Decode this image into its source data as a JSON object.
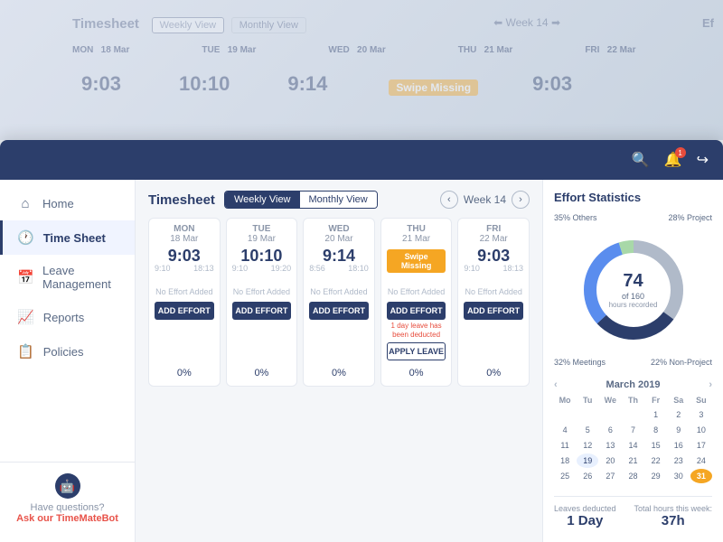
{
  "app": {
    "title": "Timesheet",
    "bg_week": "Week 14",
    "eff_label": "Ef"
  },
  "topbar": {
    "bell_count": "1"
  },
  "sidebar": {
    "items": [
      {
        "id": "home",
        "label": "Home",
        "icon": "⌂",
        "active": false
      },
      {
        "id": "timesheet",
        "label": "Time Sheet",
        "icon": "🕐",
        "active": true
      },
      {
        "id": "leave",
        "label": "Leave Management",
        "icon": "📅",
        "active": false
      },
      {
        "id": "reports",
        "label": "Reports",
        "icon": "📈",
        "active": false
      },
      {
        "id": "policies",
        "label": "Policies",
        "icon": "📋",
        "active": false
      }
    ],
    "help_text": "Have questions?",
    "bot_link": "Ask our TimeMateBot"
  },
  "timesheet": {
    "title": "Timesheet",
    "views": [
      {
        "label": "Weekly View",
        "active": true
      },
      {
        "label": "Monthly View",
        "active": false
      }
    ],
    "week_label": "Week 14",
    "days": [
      {
        "day": "MON",
        "date": "18 Mar",
        "time": "9:03",
        "time_start": "9:10",
        "time_end": "18:13",
        "swipe_missing": false,
        "no_effort": "No Effort Added",
        "add_effort": "ADD EFFORT",
        "percent": "0%"
      },
      {
        "day": "TUE",
        "date": "19 Mar",
        "time": "10:10",
        "time_start": "9:10",
        "time_end": "19:20",
        "swipe_missing": false,
        "no_effort": "No Effort Added",
        "add_effort": "ADD EFFORT",
        "percent": "0%"
      },
      {
        "day": "WED",
        "date": "20 Mar",
        "time": "9:14",
        "time_start": "8:56",
        "time_end": "18:10",
        "swipe_missing": false,
        "no_effort": "No Effort Added",
        "add_effort": "ADD EFFORT",
        "percent": "0%"
      },
      {
        "day": "THU",
        "date": "21 Mar",
        "time": "",
        "time_start": "",
        "time_end": "",
        "swipe_missing": true,
        "swipe_label": "Swipe Missing",
        "no_effort": "No Effort Added",
        "add_effort": "ADD EFFORT",
        "leave_note": "1 day leave has been deducted",
        "apply_leave": "APPLY LEAVE",
        "percent": "0%"
      },
      {
        "day": "FRI",
        "date": "22 Mar",
        "time": "9:03",
        "time_start": "9:10",
        "time_end": "18:13",
        "swipe_missing": false,
        "no_effort": "No Effort Added",
        "add_effort": "ADD EFFORT",
        "percent": "0%"
      }
    ]
  },
  "effort": {
    "title": "Effort Statistics",
    "donut": {
      "center_number": "74",
      "of_label": "of 160",
      "sub_label": "hours recorded",
      "segments": [
        {
          "label": "35% Others",
          "color": "#b0bac9",
          "pct": 35,
          "pos": "left-top"
        },
        {
          "label": "28% Project",
          "color": "#2c3e6b",
          "pct": 28,
          "pos": "right-top"
        },
        {
          "label": "32% Meetings",
          "color": "#5a8dee",
          "pct": 32,
          "pos": "left-bottom"
        },
        {
          "label": "22% Non-Project",
          "color": "#a8d8a8",
          "pct": 22,
          "pos": "right-bottom"
        }
      ]
    },
    "calendar": {
      "month": "March 2019",
      "headers": [
        "Mo",
        "Tu",
        "We",
        "Th",
        "Fr",
        "Sa",
        "Su"
      ],
      "rows": [
        [
          "",
          "",
          "",
          "",
          "1",
          "2",
          "3"
        ],
        [
          "4",
          "5",
          "6",
          "7",
          "8",
          "9",
          "10"
        ],
        [
          "11",
          "12",
          "13",
          "14",
          "15",
          "16",
          "17"
        ],
        [
          "18",
          "19",
          "20",
          "21",
          "22",
          "23",
          "24"
        ],
        [
          "25",
          "26",
          "27",
          "28",
          "29",
          "30",
          "31"
        ]
      ],
      "today": "31",
      "highlighted": "19"
    },
    "footer": {
      "leaves_label": "Leaves deducted",
      "leaves_value": "1 Day",
      "hours_label": "Total hours this week:",
      "hours_value": "37h"
    }
  }
}
